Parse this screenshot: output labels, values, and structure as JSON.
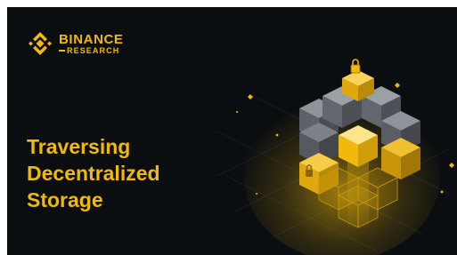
{
  "brand": {
    "name": "BINANCE",
    "sub": "RESEARCH",
    "color": "#f0b90b"
  },
  "title": {
    "line1": "Traversing",
    "line2": "Decentralized",
    "line3": "Storage"
  },
  "icons": {
    "logo": "binance-diamond-icon",
    "illustration": "storage-cube-grid-icon",
    "lock": "lock-icon"
  },
  "colors": {
    "background": "#0b0e11",
    "accent": "#f0b90b",
    "cube_gray": "#6b6f75"
  }
}
